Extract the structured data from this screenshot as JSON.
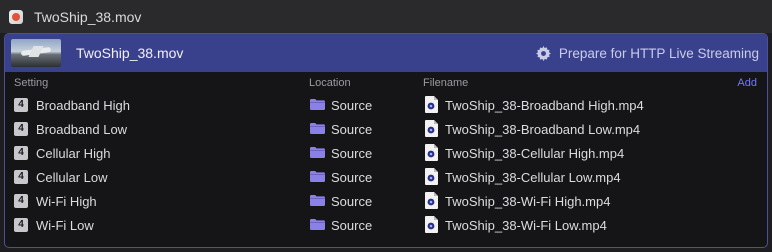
{
  "window": {
    "title": "TwoShip_38.mov"
  },
  "job": {
    "name": "TwoShip_38.mov",
    "preset_label": "Prepare for HTTP Live Streaming"
  },
  "columns": {
    "setting": "Setting",
    "location": "Location",
    "filename": "Filename",
    "add": "Add"
  },
  "rows": [
    {
      "badge": "4",
      "setting": "Broadband High",
      "location": "Source",
      "filename": "TwoShip_38-Broadband High.mp4"
    },
    {
      "badge": "4",
      "setting": "Broadband Low",
      "location": "Source",
      "filename": "TwoShip_38-Broadband Low.mp4"
    },
    {
      "badge": "4",
      "setting": "Cellular High",
      "location": "Source",
      "filename": "TwoShip_38-Cellular High.mp4"
    },
    {
      "badge": "4",
      "setting": "Cellular Low",
      "location": "Source",
      "filename": "TwoShip_38-Cellular Low.mp4"
    },
    {
      "badge": "4",
      "setting": "Wi-Fi High",
      "location": "Source",
      "filename": "TwoShip_38-Wi-Fi High.mp4"
    },
    {
      "badge": "4",
      "setting": "Wi-Fi Low",
      "location": "Source",
      "filename": "TwoShip_38-Wi-Fi Low.mp4"
    }
  ],
  "icons": {
    "app": "compressor-app-icon",
    "thumbnail": "video-thumbnail",
    "preset": "gear-icon",
    "location": "folder-icon",
    "file": "mp4-file-icon"
  },
  "colors": {
    "header_bar": "#3a418c",
    "panel_border": "#4b5198",
    "add_link": "#6b78ff",
    "folder": "#8a80e8"
  }
}
